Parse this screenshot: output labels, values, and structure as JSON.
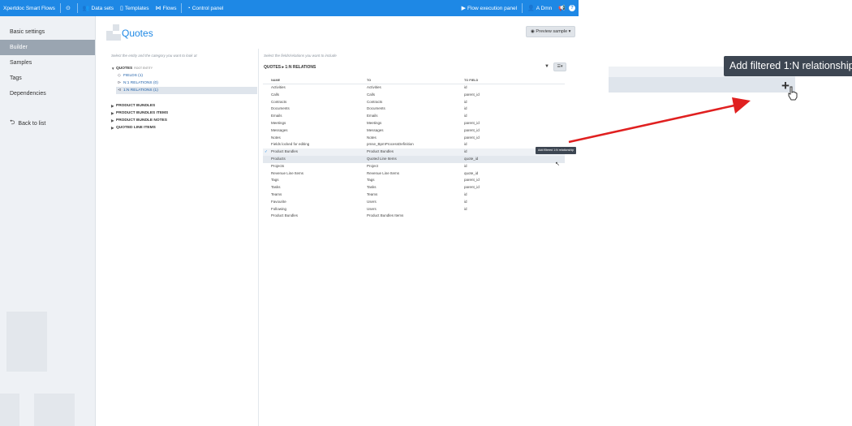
{
  "topbar": {
    "app_name": "Xpertdoc Smart Flows",
    "nav": [
      {
        "label": "Data sets",
        "icon": "people-icon"
      },
      {
        "label": "Templates",
        "icon": "document-icon"
      },
      {
        "label": "Flows",
        "icon": "flows-icon"
      },
      {
        "label": "Control panel",
        "icon": "gauge-icon"
      }
    ],
    "flow_panel": "Flow execution panel",
    "user": "A Dmn",
    "help": "?"
  },
  "sidebar": {
    "items": [
      "Basic settings",
      "Builder",
      "Samples",
      "Tags",
      "Dependencies"
    ],
    "active": "Builder",
    "back": "Back to list"
  },
  "main": {
    "title": "Quotes",
    "preview_button": "Preview sample",
    "left_hint": "Select the entity and the category you want to look at",
    "right_hint": "Select the fields/relations you want to include"
  },
  "tree": {
    "root": "QUOTES",
    "root_sub": "ROOT ENTITY",
    "children": [
      {
        "label": "FIELDS (1)",
        "glyph": "◇"
      },
      {
        "label": "N:1 RELATIONS (0)",
        "glyph": "⊳"
      },
      {
        "label": "1:N RELATIONS (1)",
        "glyph": "⊲"
      }
    ],
    "others": [
      "PRODUCT BUNDLES",
      "PRODUCT BUNDLES ITEMS",
      "PRODUCT BUNDLE NOTES",
      "QUOTED LINE ITEMS"
    ]
  },
  "content": {
    "breadcrumb": "QUOTES ▸ 1:N RELATIONS",
    "columns": [
      "NAME",
      "TO",
      "TO FIELD"
    ],
    "rows": [
      [
        "Activities",
        "Activities",
        "id"
      ],
      [
        "Calls",
        "Calls",
        "parent_id"
      ],
      [
        "Contracts",
        "Contracts",
        "id"
      ],
      [
        "Documents",
        "Documents",
        "id"
      ],
      [
        "Emails",
        "Emails",
        "id"
      ],
      [
        "Meetings",
        "Meetings",
        "parent_id"
      ],
      [
        "Messages",
        "Messages",
        "parent_id"
      ],
      [
        "Notes",
        "Notes",
        "parent_id"
      ],
      [
        "Fields locked for editing",
        "pmse_BpmProcessDefinition",
        "id"
      ],
      [
        "Product Bundles",
        "Product Bundles",
        "id"
      ],
      [
        "Products",
        "Quoted Line Items",
        "quote_id"
      ],
      [
        "Projects",
        "Project",
        "id"
      ],
      [
        "Revenue Line Items",
        "Revenue Line Items",
        "quote_id"
      ],
      [
        "Tags",
        "Tags",
        "parent_id"
      ],
      [
        "Tasks",
        "Tasks",
        "parent_id"
      ],
      [
        "Teams",
        "Teams",
        "id"
      ],
      [
        "Favourite",
        "Users",
        "id"
      ],
      [
        "Following",
        "Users",
        "id"
      ],
      [
        "Product Bundles",
        "Product Bundles Items",
        ""
      ]
    ],
    "checked_row": 9,
    "hover_row": 10,
    "tooltip_small": "Add filtered 1:N relationship"
  },
  "zoom": {
    "tooltip": "Add filtered 1:N relationship",
    "plus": "+"
  },
  "colors": {
    "brand": "#1e88e5",
    "arrow": "#e02020",
    "tooltip_bg": "#3d4652"
  }
}
